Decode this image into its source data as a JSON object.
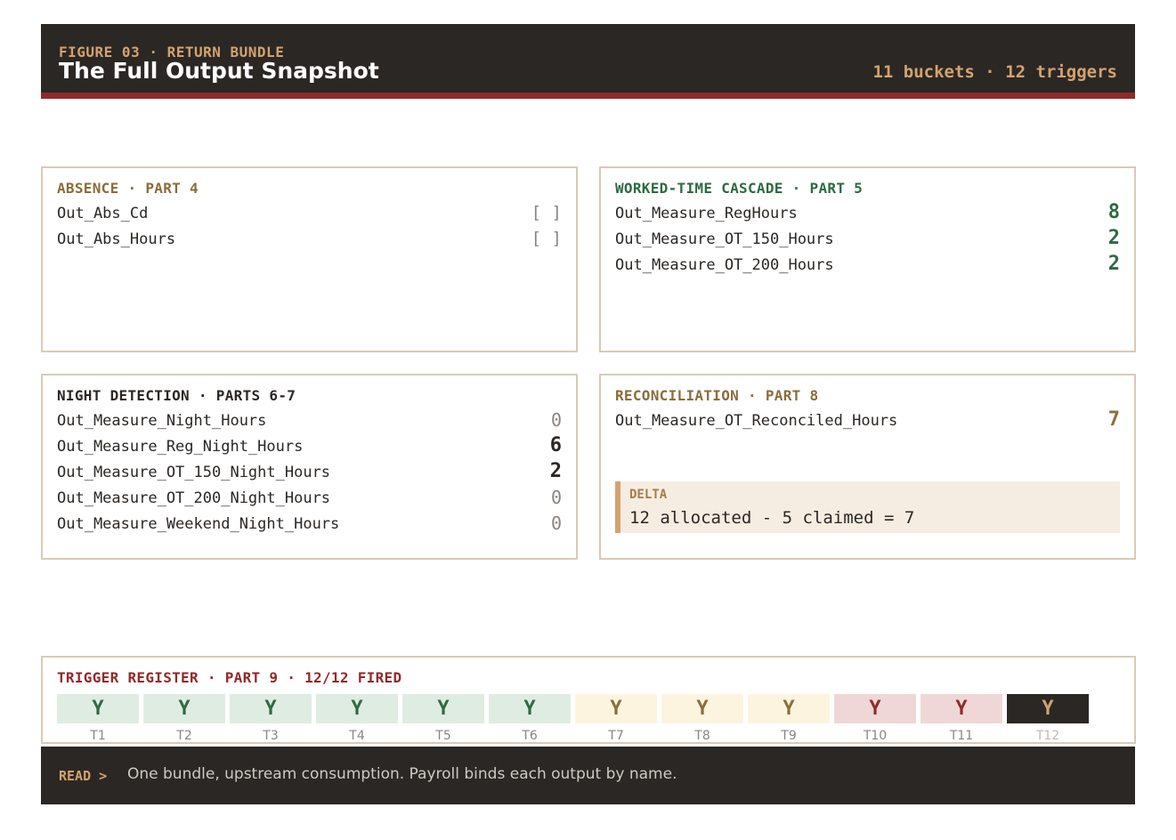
{
  "header": {
    "kicker": "FIGURE 03 · RETURN BUNDLE",
    "title": "The Full Output Snapshot",
    "meta": "11 buckets · 12 triggers"
  },
  "colors": {
    "dark": "#2b2724",
    "accent_red": "#8e2b2a",
    "accent_tan": "#d4a26f",
    "green": "#2e6a43",
    "gold": "#8a6d3b"
  },
  "absence": {
    "title": "ABSENCE · PART 4",
    "rows": [
      {
        "label": "Out_Abs_Cd",
        "value": "[ ]"
      },
      {
        "label": "Out_Abs_Hours",
        "value": "[ ]"
      }
    ]
  },
  "worked": {
    "title": "WORKED-TIME CASCADE · PART 5",
    "rows": [
      {
        "label": "Out_Measure_RegHours",
        "value": "8"
      },
      {
        "label": "Out_Measure_OT_150_Hours",
        "value": "2"
      },
      {
        "label": "Out_Measure_OT_200_Hours",
        "value": "2"
      }
    ]
  },
  "night": {
    "title": "NIGHT DETECTION · PARTS 6-7",
    "rows": [
      {
        "label": "Out_Measure_Night_Hours",
        "value": "0"
      },
      {
        "label": "Out_Measure_Reg_Night_Hours",
        "value": "6"
      },
      {
        "label": "Out_Measure_OT_150_Night_Hours",
        "value": "2"
      },
      {
        "label": "Out_Measure_OT_200_Night_Hours",
        "value": "0"
      },
      {
        "label": "Out_Measure_Weekend_Night_Hours",
        "value": "0"
      }
    ]
  },
  "recon": {
    "title": "RECONCILIATION · PART 8",
    "rows": [
      {
        "label": "Out_Measure_OT_Reconciled_Hours",
        "value": "7"
      }
    ],
    "delta_label": "DELTA",
    "delta_text": "12 allocated - 5 claimed = 7"
  },
  "triggers": {
    "title": "TRIGGER REGISTER · PART 9 · 12/12 FIRED",
    "cells": [
      {
        "label": "T1",
        "value": "Y"
      },
      {
        "label": "T2",
        "value": "Y"
      },
      {
        "label": "T3",
        "value": "Y"
      },
      {
        "label": "T4",
        "value": "Y"
      },
      {
        "label": "T5",
        "value": "Y"
      },
      {
        "label": "T6",
        "value": "Y"
      },
      {
        "label": "T7",
        "value": "Y"
      },
      {
        "label": "T8",
        "value": "Y"
      },
      {
        "label": "T9",
        "value": "Y"
      },
      {
        "label": "T10",
        "value": "Y"
      },
      {
        "label": "T11",
        "value": "Y"
      },
      {
        "label": "T12",
        "value": "Y"
      }
    ]
  },
  "footer": {
    "read": "READ >",
    "text": "One bundle, upstream consumption. Payroll binds each output by name."
  }
}
